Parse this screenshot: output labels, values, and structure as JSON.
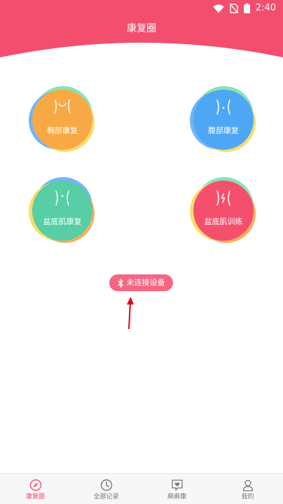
{
  "status_bar": {
    "time": "2:40",
    "icons": [
      "wifi-icon",
      "no-sim-icon",
      "battery-icon"
    ]
  },
  "header": {
    "title": "康复圈"
  },
  "modules": [
    {
      "key": "chest",
      "label": "胸部康复",
      "icon": "chest-outline-icon",
      "color": "#f8a945"
    },
    {
      "key": "abdomen",
      "label": "腹部康复",
      "icon": "abdomen-outline-icon",
      "color": "#4ea7f5"
    },
    {
      "key": "pelvic-floor-recovery",
      "label": "盆底肌康复",
      "icon": "pelvis-outline-icon",
      "color": "#57cea4"
    },
    {
      "key": "pelvic-floor-training",
      "label": "盆底肌训练",
      "icon": "pelvis-pulse-icon",
      "color": "#f4506e"
    }
  ],
  "device": {
    "status_label": "未连接设备",
    "icon": "bluetooth-icon"
  },
  "tabs": [
    {
      "key": "recovery",
      "label": "康复圈",
      "icon": "compass-icon",
      "active": true
    },
    {
      "key": "records",
      "label": "全部记录",
      "icon": "clock-icon",
      "active": false
    },
    {
      "key": "mama",
      "label": "麻麻康",
      "icon": "heart-chat-icon",
      "active": false
    },
    {
      "key": "mine",
      "label": "我的",
      "icon": "person-icon",
      "active": false
    }
  ],
  "colors": {
    "brand": "#f34e6e",
    "tab_inactive": "#777777",
    "arrow": "#e60012"
  }
}
